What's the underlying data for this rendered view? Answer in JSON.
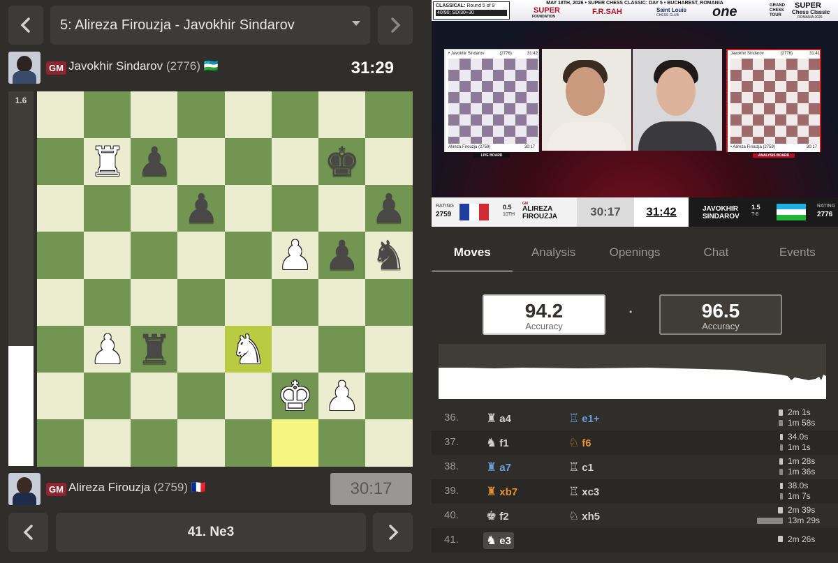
{
  "colors": {
    "board_light": "#ebecd0",
    "board_dark": "#739552",
    "highlight_light": "#f5f682",
    "highlight_dark": "#b9ca43",
    "gm_badge": "#8e2430",
    "blue_move": "#6a9fd8",
    "orange_move": "#e39335"
  },
  "game_selector": {
    "label": "5: Alireza Firouzja - Javokhir Sindarov"
  },
  "top_player": {
    "title": "GM",
    "name": "Javokhir Sindarov",
    "rating": "(2776)",
    "flag": "🇺🇿",
    "clock": "31:29"
  },
  "bottom_player": {
    "title": "GM",
    "name": "Alireza Firouzja",
    "rating": "(2759)",
    "flag": "🇫🇷",
    "clock": "30:17"
  },
  "eval": {
    "label": "1.6",
    "white_fraction": 0.32
  },
  "board": {
    "highlight": [
      "e3",
      "f1"
    ],
    "pieces": [
      {
        "sq": "b7",
        "p": "♜",
        "c": "w"
      },
      {
        "sq": "c7",
        "p": "♟",
        "c": "b"
      },
      {
        "sq": "g7",
        "p": "♚",
        "c": "b"
      },
      {
        "sq": "d6",
        "p": "♟",
        "c": "b"
      },
      {
        "sq": "h6",
        "p": "♟",
        "c": "b"
      },
      {
        "sq": "f5",
        "p": "♟",
        "c": "w"
      },
      {
        "sq": "g5",
        "p": "♟",
        "c": "b"
      },
      {
        "sq": "h5",
        "p": "♞",
        "c": "b"
      },
      {
        "sq": "b3",
        "p": "♟",
        "c": "w"
      },
      {
        "sq": "c3",
        "p": "♜",
        "c": "b"
      },
      {
        "sq": "e3",
        "p": "♞",
        "c": "w"
      },
      {
        "sq": "f2",
        "p": "♚",
        "c": "w"
      },
      {
        "sq": "g2",
        "p": "♟",
        "c": "w"
      }
    ]
  },
  "video": {
    "header": {
      "event": "CLASSICAL:",
      "round": "Round 5 of 9",
      "time_control": "40/90; SD/30+30",
      "date_line": "MAY 18TH, 2026 • SUPER CHESS CLASSIC: DAY 5 • BUCHAREST, ROMANIA",
      "brand_left": "SUPER",
      "brand_left_sub": "FOUNDATION",
      "sponsor": "F.R.SAH",
      "club": "Saint Louis",
      "club_sub": "CHESS CLUB",
      "one": "one",
      "tour": "GRAND CHESS TOUR",
      "super_right": "SUPER",
      "classic_right": "Chess Classic",
      "classic_sub": "ROMANIA 2026"
    },
    "live_board": {
      "top_name": "• Javokhir Sindarov",
      "top_rating": "(2776)",
      "top_clock": "31:42",
      "bottom_name": "Alireza Firouzja",
      "bottom_rating": "(2759)",
      "bottom_clock": "30:17",
      "label": "LIVE BOARD"
    },
    "analysis_board": {
      "top_name": "Javokhir Sindarov",
      "top_rating": "(2776)",
      "top_clock": "31:41",
      "bottom_name": "• Alireza Firouzja",
      "bottom_rating": "(2759)",
      "bottom_clock": "30:17",
      "label": "ANALYSIS BOARD"
    },
    "scorebar": {
      "left_rating_label": "RATING",
      "left_rating": "2759",
      "left_score": "0.5",
      "left_rank": "10TH",
      "left_title": "GM",
      "left_first": "ALIREZA",
      "left_last": "FIROUZJA",
      "left_clock": "30:17",
      "right_clock": "31:42",
      "right_first": "JAVOKHIR",
      "right_last": "SINDAROV",
      "right_score": "1.5",
      "right_rank": "T-8",
      "right_rating_label": "RATING",
      "right_rating": "2776"
    }
  },
  "tabs": [
    "Moves",
    "Analysis",
    "Openings",
    "Chat",
    "Events"
  ],
  "accuracy": {
    "white": "94.2",
    "black": "96.5",
    "label": "Accuracy",
    "separator": "•"
  },
  "moves": [
    {
      "num": "36.",
      "w_icon": "♜",
      "w": "a4",
      "w_color": "#d4d3d2",
      "b_icon": "♖",
      "b": "e1+",
      "b_color": "#6a9fd8",
      "t1": "2m 1s",
      "t2": "1m 58s",
      "b1": 0.08,
      "b2": 0.08
    },
    {
      "num": "37.",
      "w_icon": "♞",
      "w": "f1",
      "w_color": "#d4d3d2",
      "b_icon": "♘",
      "b": "f6",
      "b_color": "#e39335",
      "t1": "34.0s",
      "t2": "1m 1s",
      "b1": 0.05,
      "b2": 0.05
    },
    {
      "num": "38.",
      "w_icon": "♜",
      "w": "a7",
      "w_color": "#6a9fd8",
      "b_icon": "♖",
      "b": "c1",
      "b_color": "#d4d3d2",
      "t1": "1m 28s",
      "t2": "1m 36s",
      "b1": 0.07,
      "b2": 0.07
    },
    {
      "num": "39.",
      "w_icon": "♜",
      "w": "xb7",
      "w_color": "#e39335",
      "b_icon": "♖",
      "b": "xc3",
      "b_color": "#d4d3d2",
      "t1": "38.0s",
      "t2": "1m 7s",
      "b1": 0.05,
      "b2": 0.05
    },
    {
      "num": "40.",
      "w_icon": "♚",
      "w": "f2",
      "w_color": "#d4d3d2",
      "b_icon": "♘",
      "b": "xh5",
      "b_color": "#d4d3d2",
      "t1": "2m 39s",
      "t2": "13m 29s",
      "b1": 0.1,
      "b2": 0.5
    },
    {
      "num": "41.",
      "w_icon": "♞",
      "w": "e3",
      "w_color": "#ffffff",
      "b_icon": "",
      "b": "",
      "b_color": "#d4d3d2",
      "t1": "2m 26s",
      "t2": "",
      "b1": 0.1,
      "b2": 0
    }
  ],
  "current_move": "41. Ne3",
  "icons": {
    "prev": "chevron-left-icon",
    "next": "chevron-right-icon",
    "dropdown": "caret-down-icon"
  }
}
